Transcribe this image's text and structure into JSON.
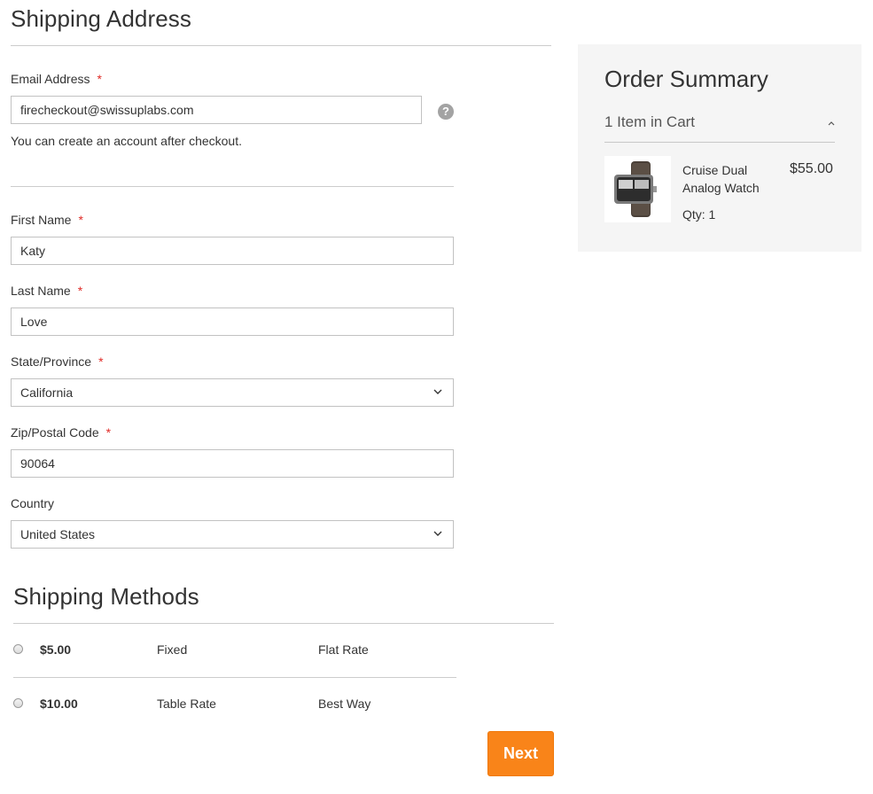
{
  "shipping_address": {
    "title": "Shipping Address",
    "email": {
      "label": "Email Address",
      "required_mark": "*",
      "value": "firecheckout@swissuplabs.com",
      "note": "You can create an account after checkout."
    },
    "help_icon": "question-circle-icon",
    "first_name": {
      "label": "First Name",
      "required_mark": "*",
      "value": "Katy"
    },
    "last_name": {
      "label": "Last Name",
      "required_mark": "*",
      "value": "Love"
    },
    "state": {
      "label": "State/Province",
      "required_mark": "*",
      "selected": "California"
    },
    "zip": {
      "label": "Zip/Postal Code",
      "required_mark": "*",
      "value": "90064"
    },
    "country": {
      "label": "Country",
      "selected": "United States"
    }
  },
  "shipping_methods": {
    "title": "Shipping Methods",
    "rows": [
      {
        "price": "$5.00",
        "method": "Fixed",
        "carrier": "Flat Rate",
        "selected": false
      },
      {
        "price": "$10.00",
        "method": "Table Rate",
        "carrier": "Best Way",
        "selected": false
      }
    ]
  },
  "actions": {
    "next_label": "Next"
  },
  "order_summary": {
    "title": "Order Summary",
    "items_in_cart": "1 Item in Cart",
    "collapse_icon": "chevron-up-icon",
    "items": [
      {
        "name": "Cruise Dual Analog Watch",
        "price": "$55.00",
        "qty": "Qty: 1",
        "image_icon": "watch-icon"
      }
    ]
  },
  "colors": {
    "accent": "#f98419",
    "required": "#e02b27",
    "summary_bg": "#f5f5f5",
    "rule": "#cccccc"
  }
}
